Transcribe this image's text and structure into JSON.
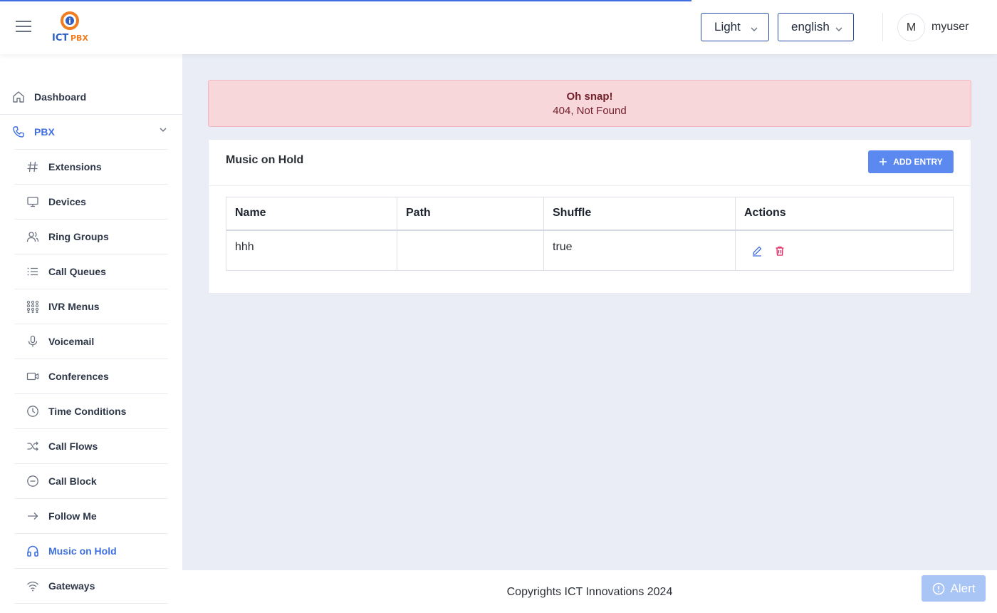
{
  "header": {
    "logo_text": "ICT PBX",
    "theme_select": "Light",
    "language_select": "english",
    "avatar_initial": "M",
    "username": "myuser"
  },
  "sidebar": {
    "dashboard": "Dashboard",
    "pbx": "PBX",
    "items": [
      {
        "label": "Extensions",
        "icon": "hash-icon"
      },
      {
        "label": "Devices",
        "icon": "monitor-icon"
      },
      {
        "label": "Ring Groups",
        "icon": "users-icon"
      },
      {
        "label": "Call Queues",
        "icon": "list-icon"
      },
      {
        "label": "IVR Menus",
        "icon": "dialpad-icon"
      },
      {
        "label": "Voicemail",
        "icon": "mic-icon"
      },
      {
        "label": "Conferences",
        "icon": "video-icon"
      },
      {
        "label": "Time Conditions",
        "icon": "clock-icon"
      },
      {
        "label": "Call Flows",
        "icon": "shuffle-icon"
      },
      {
        "label": "Call Block",
        "icon": "minus-circle-icon"
      },
      {
        "label": "Follow Me",
        "icon": "arrow-right-icon"
      },
      {
        "label": "Music on Hold",
        "icon": "headphones-icon",
        "active": true
      },
      {
        "label": "Gateways",
        "icon": "wifi-icon"
      }
    ],
    "active_color": "#3e6ee0"
  },
  "alert": {
    "title": "Oh snap!",
    "message": "404, Not Found"
  },
  "card": {
    "title": "Music on Hold",
    "add_button": "ADD ENTRY",
    "columns": [
      "Name",
      "Path",
      "Shuffle",
      "Actions"
    ],
    "rows": [
      {
        "name": "hhh",
        "path": "",
        "shuffle": "true"
      }
    ]
  },
  "footer": {
    "copyright": "Copyrights ICT Innovations 2024",
    "alert_button": "Alert"
  }
}
